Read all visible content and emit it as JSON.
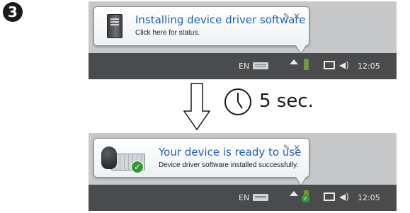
{
  "step": {
    "number": "3"
  },
  "before": {
    "balloon": {
      "title": "Installing device driver software",
      "subtitle": "Click here for status.",
      "icon": "computer-tower-icon"
    },
    "taskbar": {
      "language": "EN",
      "clock": "12:05"
    }
  },
  "transition": {
    "arrow_icon": "down-arrow-icon",
    "clock_icon": "clock-icon",
    "label": "5 sec."
  },
  "after": {
    "balloon": {
      "title": "Your device is ready to use",
      "subtitle": "Device driver software installed successfully.",
      "icon": "mouse-keyboard-check-icon"
    },
    "taskbar": {
      "language": "EN",
      "clock": "12:05"
    }
  },
  "colors": {
    "title_blue": "#1f63b6",
    "taskbar": "#4a4b4d",
    "panel_bg": "#c6c8ca",
    "success_green": "#2f9a34"
  }
}
